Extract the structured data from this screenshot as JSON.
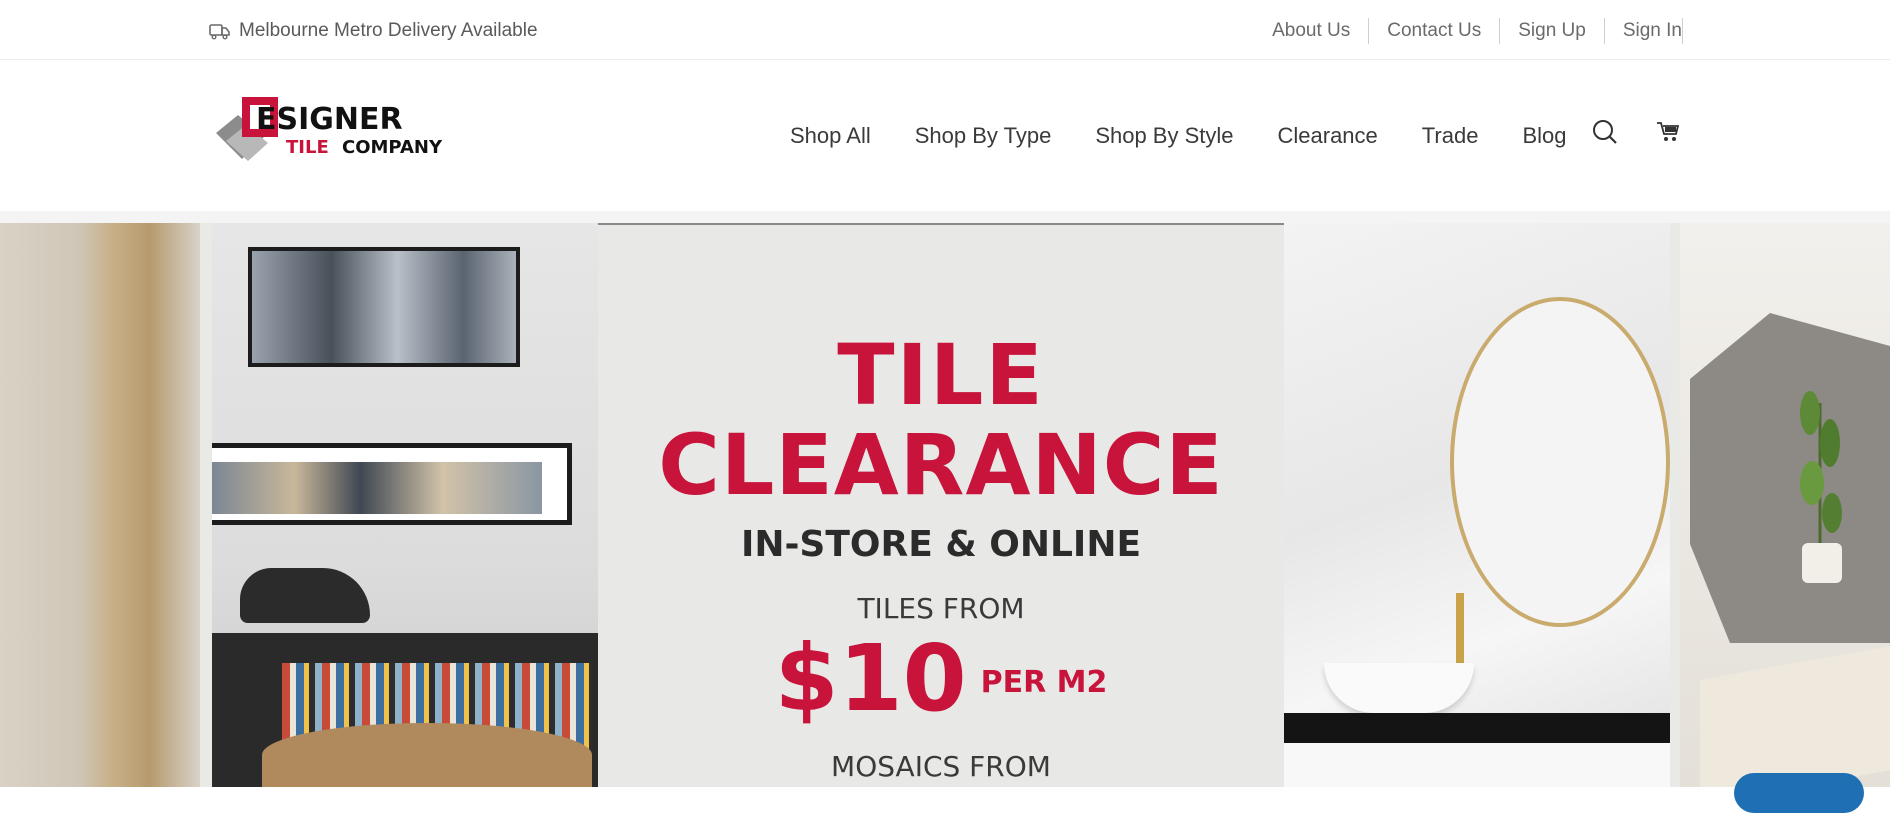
{
  "topbar": {
    "delivery_text": "Melbourne Metro Delivery Available",
    "links": [
      "About Us",
      "Contact Us",
      "Sign Up",
      "Sign In"
    ]
  },
  "header": {
    "logo_text": "Designer Tile Company",
    "nav": [
      "Shop All",
      "Shop By Type",
      "Shop By Style",
      "Clearance",
      "Trade",
      "Blog"
    ],
    "icons": [
      "search-icon",
      "cart-icon"
    ]
  },
  "hero": {
    "title_line1": "TILE",
    "title_line2": "CLEARANCE",
    "subtitle": "IN-STORE & ONLINE",
    "tiles_from": "TILES FROM",
    "price": "$10",
    "per_unit": "PER M2",
    "mosaics_from": "MOSAICS FROM"
  },
  "colors": {
    "brand_red": "#c8133a",
    "text_dark": "#3a3a3a"
  }
}
